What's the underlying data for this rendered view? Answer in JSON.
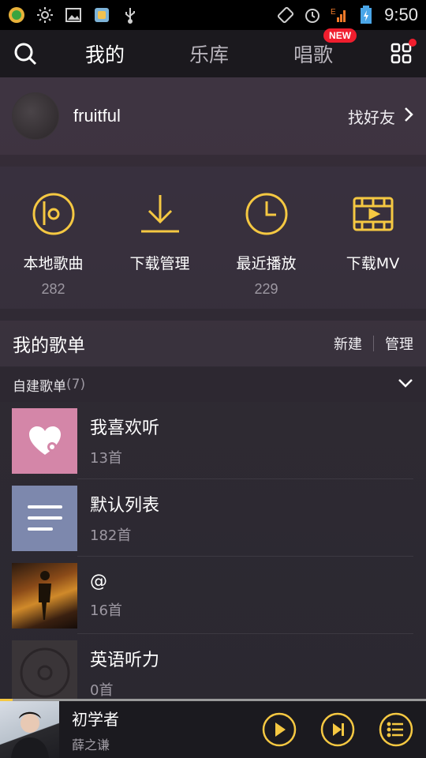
{
  "status_bar": {
    "time": "9:50",
    "icons": [
      "clover-icon",
      "brightness-icon",
      "image-icon",
      "app-icon",
      "usb-icon",
      "rotate-icon",
      "alarm-icon",
      "signal-icon",
      "battery-icon"
    ]
  },
  "nav": {
    "tabs": [
      {
        "label": "我的"
      },
      {
        "label": "乐库"
      },
      {
        "label": "唱歌"
      }
    ],
    "new_badge": "NEW"
  },
  "profile": {
    "username": "fruitful",
    "find_friends": "找好友"
  },
  "quick_actions": [
    {
      "label": "本地歌曲",
      "count": "282",
      "icon": "local-songs-icon"
    },
    {
      "label": "下载管理",
      "count": "",
      "icon": "download-icon"
    },
    {
      "label": "最近播放",
      "count": "229",
      "icon": "clock-icon"
    },
    {
      "label": "下载MV",
      "count": "",
      "icon": "video-icon"
    }
  ],
  "playlists": {
    "title": "我的歌单",
    "new_label": "新建",
    "manage_label": "管理",
    "section_label": "自建歌单",
    "section_count": "(7)",
    "items": [
      {
        "title": "我喜欢听",
        "count": "13首"
      },
      {
        "title": "默认列表",
        "count": "182首"
      },
      {
        "title": "@",
        "count": "16首"
      },
      {
        "title": "英语听力",
        "count": "0首"
      }
    ]
  },
  "player": {
    "song": "初学者",
    "artist": "薛之谦",
    "progress": 0.03
  },
  "colors": {
    "accent": "#f5c842",
    "badge_red": "#f01e2e",
    "nav_bg": "#1b191e"
  }
}
